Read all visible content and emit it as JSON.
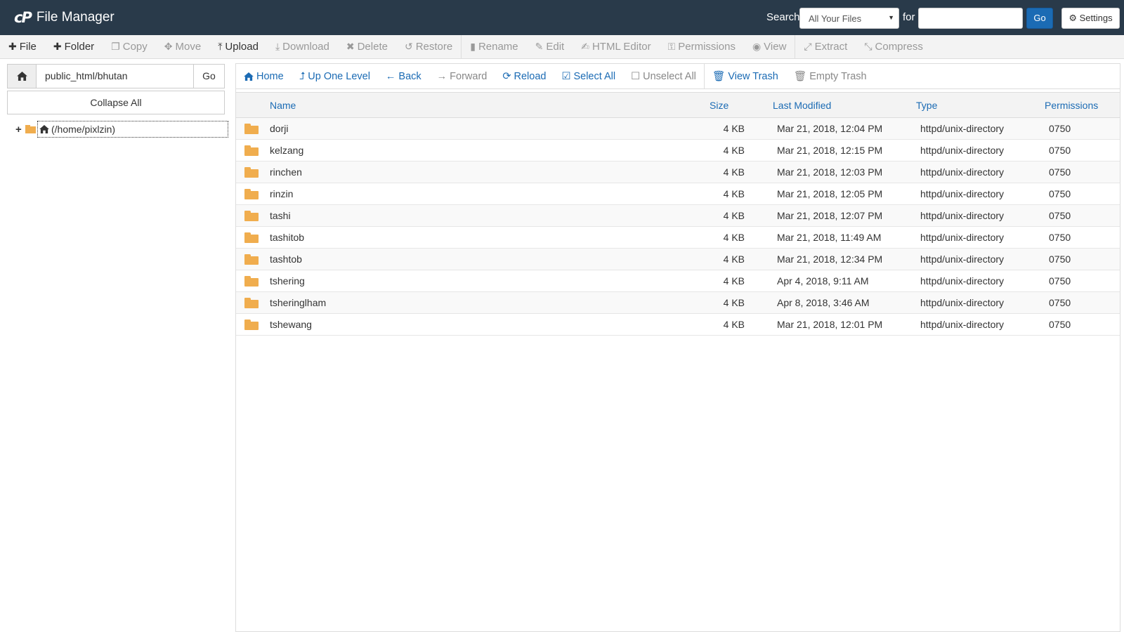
{
  "header": {
    "logo": "cP",
    "title": "File Manager",
    "search_label": "Search",
    "search_scope": "All Your Files",
    "for_label": "for",
    "search_value": "",
    "go_label": "Go",
    "settings_label": "Settings"
  },
  "toolbar": {
    "file": "File",
    "folder": "Folder",
    "copy": "Copy",
    "move": "Move",
    "upload": "Upload",
    "download": "Download",
    "delete": "Delete",
    "restore": "Restore",
    "rename": "Rename",
    "edit": "Edit",
    "html_editor": "HTML Editor",
    "permissions": "Permissions",
    "view": "View",
    "extract": "Extract",
    "compress": "Compress"
  },
  "sidebar": {
    "path": "public_html/bhutan",
    "go_label": "Go",
    "collapse_label": "Collapse All",
    "tree_root": "(/home/pixlzin)"
  },
  "nav": {
    "home": "Home",
    "up": "Up One Level",
    "back": "Back",
    "forward": "Forward",
    "reload": "Reload",
    "select_all": "Select All",
    "unselect_all": "Unselect All",
    "view_trash": "View Trash",
    "empty_trash": "Empty Trash"
  },
  "table": {
    "columns": {
      "name": "Name",
      "size": "Size",
      "modified": "Last Modified",
      "type": "Type",
      "permissions": "Permissions"
    },
    "rows": [
      {
        "name": "dorji",
        "size": "4 KB",
        "modified": "Mar 21, 2018, 12:04 PM",
        "type": "httpd/unix-directory",
        "perms": "0750"
      },
      {
        "name": "kelzang",
        "size": "4 KB",
        "modified": "Mar 21, 2018, 12:15 PM",
        "type": "httpd/unix-directory",
        "perms": "0750"
      },
      {
        "name": "rinchen",
        "size": "4 KB",
        "modified": "Mar 21, 2018, 12:03 PM",
        "type": "httpd/unix-directory",
        "perms": "0750"
      },
      {
        "name": "rinzin",
        "size": "4 KB",
        "modified": "Mar 21, 2018, 12:05 PM",
        "type": "httpd/unix-directory",
        "perms": "0750"
      },
      {
        "name": "tashi",
        "size": "4 KB",
        "modified": "Mar 21, 2018, 12:07 PM",
        "type": "httpd/unix-directory",
        "perms": "0750"
      },
      {
        "name": "tashitob",
        "size": "4 KB",
        "modified": "Mar 21, 2018, 11:49 AM",
        "type": "httpd/unix-directory",
        "perms": "0750"
      },
      {
        "name": "tashtob",
        "size": "4 KB",
        "modified": "Mar 21, 2018, 12:34 PM",
        "type": "httpd/unix-directory",
        "perms": "0750"
      },
      {
        "name": "tshering",
        "size": "4 KB",
        "modified": "Apr 4, 2018, 9:11 AM",
        "type": "httpd/unix-directory",
        "perms": "0750"
      },
      {
        "name": "tsheringlham",
        "size": "4 KB",
        "modified": "Apr 8, 2018, 3:46 AM",
        "type": "httpd/unix-directory",
        "perms": "0750"
      },
      {
        "name": "tshewang",
        "size": "4 KB",
        "modified": "Mar 21, 2018, 12:01 PM",
        "type": "httpd/unix-directory",
        "perms": "0750"
      }
    ]
  },
  "icons": {
    "folder_color": "#f0ad4e",
    "accent": "#1b6bb4",
    "header_bg": "#293a4a"
  }
}
